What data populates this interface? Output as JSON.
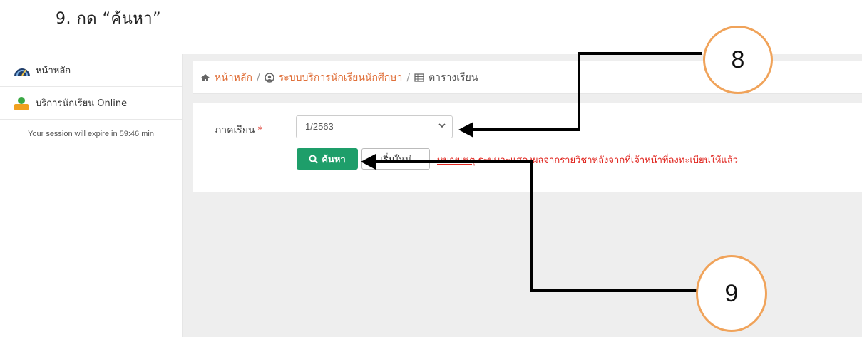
{
  "instruction": {
    "step_text": "9.  กด “ค้นหา”"
  },
  "sidebar": {
    "items": [
      {
        "label": "หน้าหลัก",
        "icon": "dashboard-gauge-icon"
      },
      {
        "label": "บริการนักเรียน Online",
        "icon": "student-user-icon"
      }
    ],
    "session_text": "Your session will expire in 59:46 min"
  },
  "breadcrumb": {
    "home_label": "หน้าหลัก",
    "service_label": "ระบบบริการนักเรียนนักศึกษา",
    "current_label": "ตารางเรียน",
    "separator": "/"
  },
  "form": {
    "semester_label": "ภาคเรียน",
    "required_mark": "*",
    "semester_value": "1/2563",
    "search_button": "ค้นหา",
    "reset_button": "เริ่มใหม่",
    "note_link": "หมายเหตุ",
    "note_text": "ระบบจะแสดงผลจากรายวิชาหลังจากที่เจ้าหน้าที่ลงทะเบียนให้แล้ว"
  },
  "annotations": {
    "callout_semester": "8",
    "callout_search": "9"
  },
  "colors": {
    "accent": "#e0703a",
    "success": "#1e9e6a",
    "warning_text": "#e0261f",
    "callout_border": "#f0a35a"
  }
}
